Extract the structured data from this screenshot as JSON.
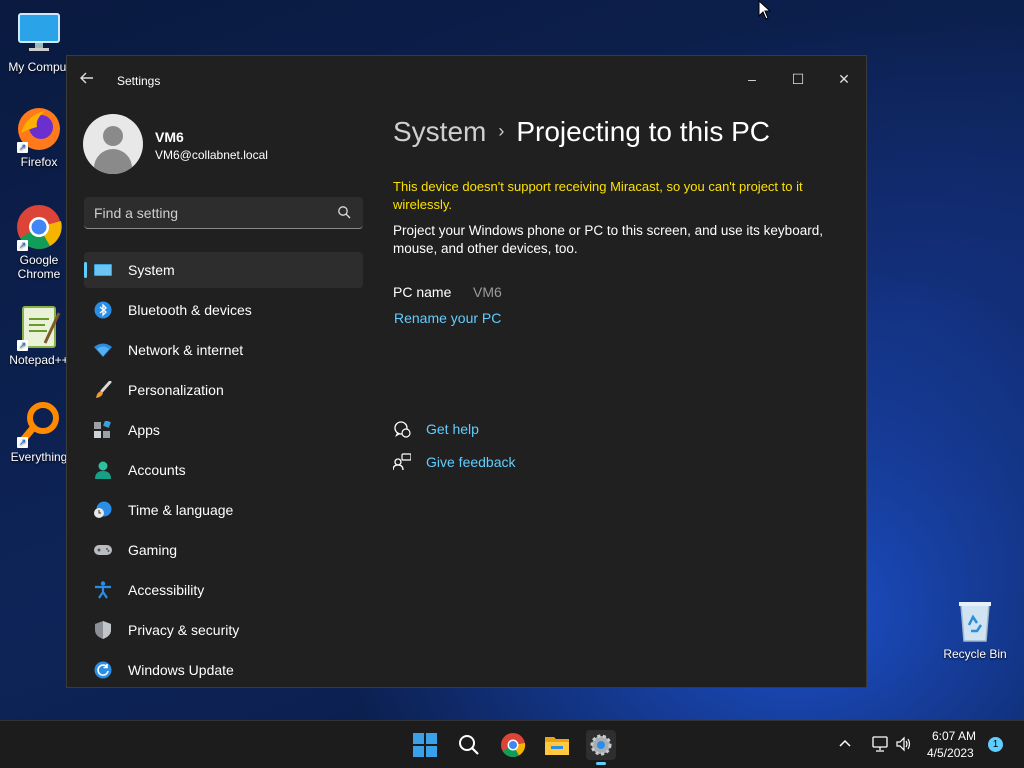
{
  "desktop": {
    "icons": [
      {
        "label": "My Comput"
      },
      {
        "label": "Firefox"
      },
      {
        "label": "Google Chrome"
      },
      {
        "label": "Notepad++"
      },
      {
        "label": "Everything"
      },
      {
        "label": "Recycle Bin"
      }
    ]
  },
  "window": {
    "title": "Settings",
    "controls": {
      "minimize": "–",
      "maximize": "☐",
      "close": "✕"
    }
  },
  "user": {
    "name": "VM6",
    "email": "VM6@collabnet.local"
  },
  "search": {
    "placeholder": "Find a setting"
  },
  "nav": {
    "items": [
      {
        "label": "System",
        "icon": "monitor-icon",
        "active": true
      },
      {
        "label": "Bluetooth & devices",
        "icon": "bluetooth-icon"
      },
      {
        "label": "Network & internet",
        "icon": "wifi-icon"
      },
      {
        "label": "Personalization",
        "icon": "brush-icon"
      },
      {
        "label": "Apps",
        "icon": "apps-icon"
      },
      {
        "label": "Accounts",
        "icon": "person-icon"
      },
      {
        "label": "Time & language",
        "icon": "globe-clock-icon"
      },
      {
        "label": "Gaming",
        "icon": "controller-icon"
      },
      {
        "label": "Accessibility",
        "icon": "accessibility-icon"
      },
      {
        "label": "Privacy & security",
        "icon": "shield-icon"
      },
      {
        "label": "Windows Update",
        "icon": "update-icon"
      }
    ]
  },
  "main": {
    "breadcrumb": {
      "parent": "System",
      "separator": "›",
      "current": "Projecting to this PC"
    },
    "warning": "This device doesn't support receiving Miracast, so you can't project to it wirelessly.",
    "description": "Project your Windows phone or PC to this screen, and use its keyboard, mouse, and other devices, too.",
    "pc_name_label": "PC name",
    "pc_name_value": "VM6",
    "rename_link": "Rename your PC",
    "help_link": "Get help",
    "feedback_link": "Give feedback"
  },
  "taskbar": {
    "time": "6:07 AM",
    "date": "4/5/2023",
    "notification_count": "1"
  },
  "colors": {
    "accent": "#60cdff",
    "warning": "#fce100",
    "window_bg": "#202020"
  }
}
